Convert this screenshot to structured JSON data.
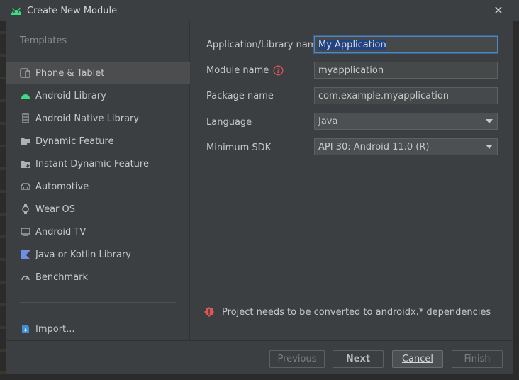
{
  "window": {
    "title": "Create New Module",
    "close_icon": "close-icon"
  },
  "templates": {
    "header": "Templates",
    "items": [
      {
        "label": "Phone & Tablet",
        "icon": "phone-tablet-icon",
        "selected": true
      },
      {
        "label": "Android Library",
        "icon": "android-icon",
        "selected": false
      },
      {
        "label": "Android Native Library",
        "icon": "native-library-icon",
        "selected": false
      },
      {
        "label": "Dynamic Feature",
        "icon": "dynamic-feature-icon",
        "selected": false
      },
      {
        "label": "Instant Dynamic Feature",
        "icon": "instant-dynamic-feature-icon",
        "selected": false
      },
      {
        "label": "Automotive",
        "icon": "car-icon",
        "selected": false
      },
      {
        "label": "Wear OS",
        "icon": "watch-icon",
        "selected": false
      },
      {
        "label": "Android TV",
        "icon": "tv-icon",
        "selected": false
      },
      {
        "label": "Java or Kotlin Library",
        "icon": "kotlin-icon",
        "selected": false
      },
      {
        "label": "Benchmark",
        "icon": "gauge-icon",
        "selected": false
      }
    ],
    "import_label": "Import..."
  },
  "form": {
    "app_name_label": "Application/Library name",
    "app_name_value": "My Application",
    "module_name_label": "Module name",
    "module_name_value": "myapplication",
    "package_name_label": "Package name",
    "package_name_value": "com.example.myapplication",
    "language_label": "Language",
    "language_value": "Java",
    "min_sdk_label": "Minimum SDK",
    "min_sdk_value": "API 30: Android 11.0 (R)"
  },
  "warning": {
    "text": "Project needs to be converted to androidx.* dependencies",
    "icon": "error-icon"
  },
  "buttons": {
    "previous": "Previous",
    "next": "Next",
    "cancel": "Cancel",
    "finish": "Finish"
  },
  "colors": {
    "accent": "#4a88c7",
    "android_green": "#3ddc84",
    "error_red": "#e05555",
    "selection": "#214283"
  }
}
